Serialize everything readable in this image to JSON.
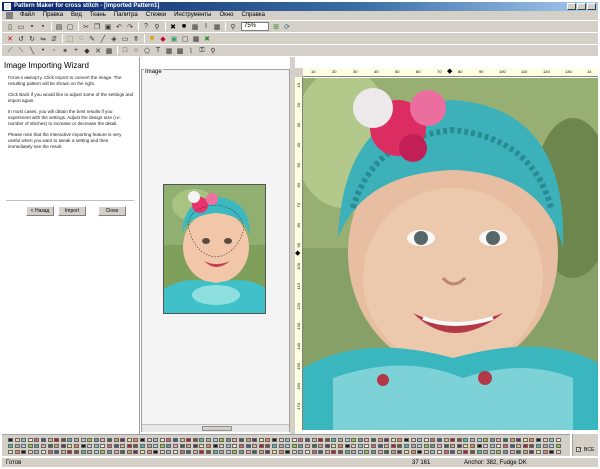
{
  "window": {
    "title": "Pattern Maker for cross stitch - [Imported Pattern1]"
  },
  "menu": [
    "Файл",
    "Правка",
    "Вид",
    "Ткань",
    "Палитра",
    "Стежки",
    "Инструменты",
    "Окно",
    "Справка"
  ],
  "toolbar": {
    "zoom_value": "75%"
  },
  "wizard": {
    "title": "Image Importing Wizard",
    "paragraphs": [
      "Готов к импорту. Click Import to convert the image. The resulting pattern will be shown on the right.",
      "Click Back if you would like to adjust some of the settings and import again.",
      "In most cases, you will obtain the best results if you experiment with the settings. Adjust the design size (i.e. number of stitches) to increase or decrease the detail.",
      "Please note that the interactive importing feature is very useful when you want to tweak a setting and then immediately see the result."
    ],
    "back_label": "< Назад",
    "import_label": "Import",
    "close_label": "Close"
  },
  "image_panel": {
    "label": "Image"
  },
  "hruler": {
    "ticks": [
      "10",
      "20",
      "30",
      "40",
      "50",
      "60",
      "70",
      "80",
      "90",
      "100",
      "110",
      "120",
      "130",
      "14"
    ]
  },
  "vruler": {
    "ticks": [
      "10",
      "20",
      "30",
      "40",
      "50",
      "60",
      "70",
      "80",
      "90",
      "100",
      "110",
      "120",
      "130",
      "140",
      "150",
      "160",
      "170"
    ]
  },
  "palette": {
    "colors": [
      "#1a1a1a",
      "#c8102e",
      "#f4a7b9",
      "#e8d0c0",
      "#7a5230",
      "#2d6a4f",
      "#8fc1e3",
      "#40c0c0",
      "#d9a066",
      "#fce4d6",
      "#b0b0b0",
      "#6b2d5c",
      "#e35d6a",
      "#a0d8ef",
      "#f0e68c",
      "#3b5998",
      "#9acd32",
      "#ff7f50",
      "#deb887",
      "#5f9ea0"
    ]
  },
  "bce": {
    "label": "BCE"
  },
  "status": {
    "mode": "Готов",
    "coords": "37  161",
    "thread": "Anchor: 382, Fudge DK"
  },
  "colors": {
    "title_start": "#0a246a",
    "title_end": "#a6caf0",
    "chrome": "#d4d0c8",
    "ruler": "#ffffe1"
  }
}
